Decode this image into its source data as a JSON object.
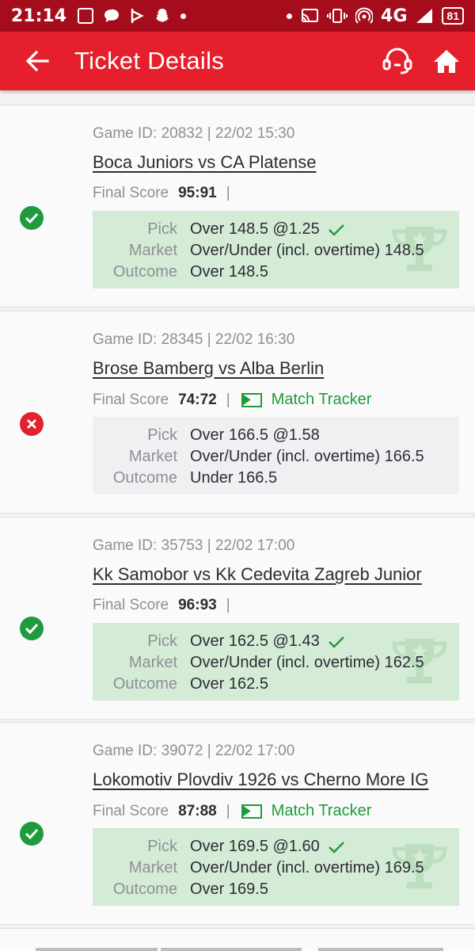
{
  "status_bar": {
    "time": "21:14",
    "network": "4G",
    "network_small": "4G",
    "battery": "81"
  },
  "app_bar": {
    "title": "Ticket Details"
  },
  "labels": {
    "final_score": "Final Score",
    "pick": "Pick",
    "market": "Market",
    "outcome": "Outcome",
    "match_tracker": "Match Tracker",
    "separator": "|"
  },
  "tickets": [
    {
      "status": "won",
      "game_line": "Game ID: 20832 | 22/02 15:30",
      "match": "Boca Juniors vs CA Platense",
      "score": "95:91",
      "has_tracker": false,
      "pick": "Over 148.5 @1.25",
      "market": "Over/Under (incl. overtime) 148.5",
      "outcome": "Over 148.5"
    },
    {
      "status": "lost",
      "game_line": "Game ID: 28345 | 22/02 16:30",
      "match": "Brose Bamberg vs Alba Berlin",
      "score": "74:72",
      "has_tracker": true,
      "pick": "Over 166.5 @1.58",
      "market": "Over/Under (incl. overtime) 166.5",
      "outcome": "Under 166.5"
    },
    {
      "status": "won",
      "game_line": "Game ID: 35753 | 22/02 17:00",
      "match": "Kk Samobor vs Kk Cedevita Zagreb Junior",
      "score": "96:93",
      "has_tracker": false,
      "pick": "Over 162.5 @1.43",
      "market": "Over/Under (incl. overtime) 162.5",
      "outcome": "Over 162.5"
    },
    {
      "status": "won",
      "game_line": "Game ID: 39072 | 22/02 17:00",
      "match": "Lokomotiv Plovdiv 1926 vs Cherno More IG",
      "score": "87:88",
      "has_tracker": true,
      "pick": "Over 169.5 @1.60",
      "market": "Over/Under (incl. overtime) 169.5",
      "outcome": "Over 169.5"
    }
  ],
  "colors": {
    "status_bar": "#a60d1c",
    "app_bar": "#e51f2b",
    "won": "#1e9b3c",
    "lost": "#e2202e",
    "won_box": "#d4ecd6",
    "lost_box": "#eff0f2"
  },
  "icons": {
    "back": "arrow-left-icon",
    "support": "headset-icon",
    "home": "home-icon",
    "won": "check-circle-icon",
    "lost": "x-circle-icon",
    "pick_won": "checkmark-icon",
    "trophy": "trophy-icon",
    "tracker": "match-tracker-icon"
  }
}
